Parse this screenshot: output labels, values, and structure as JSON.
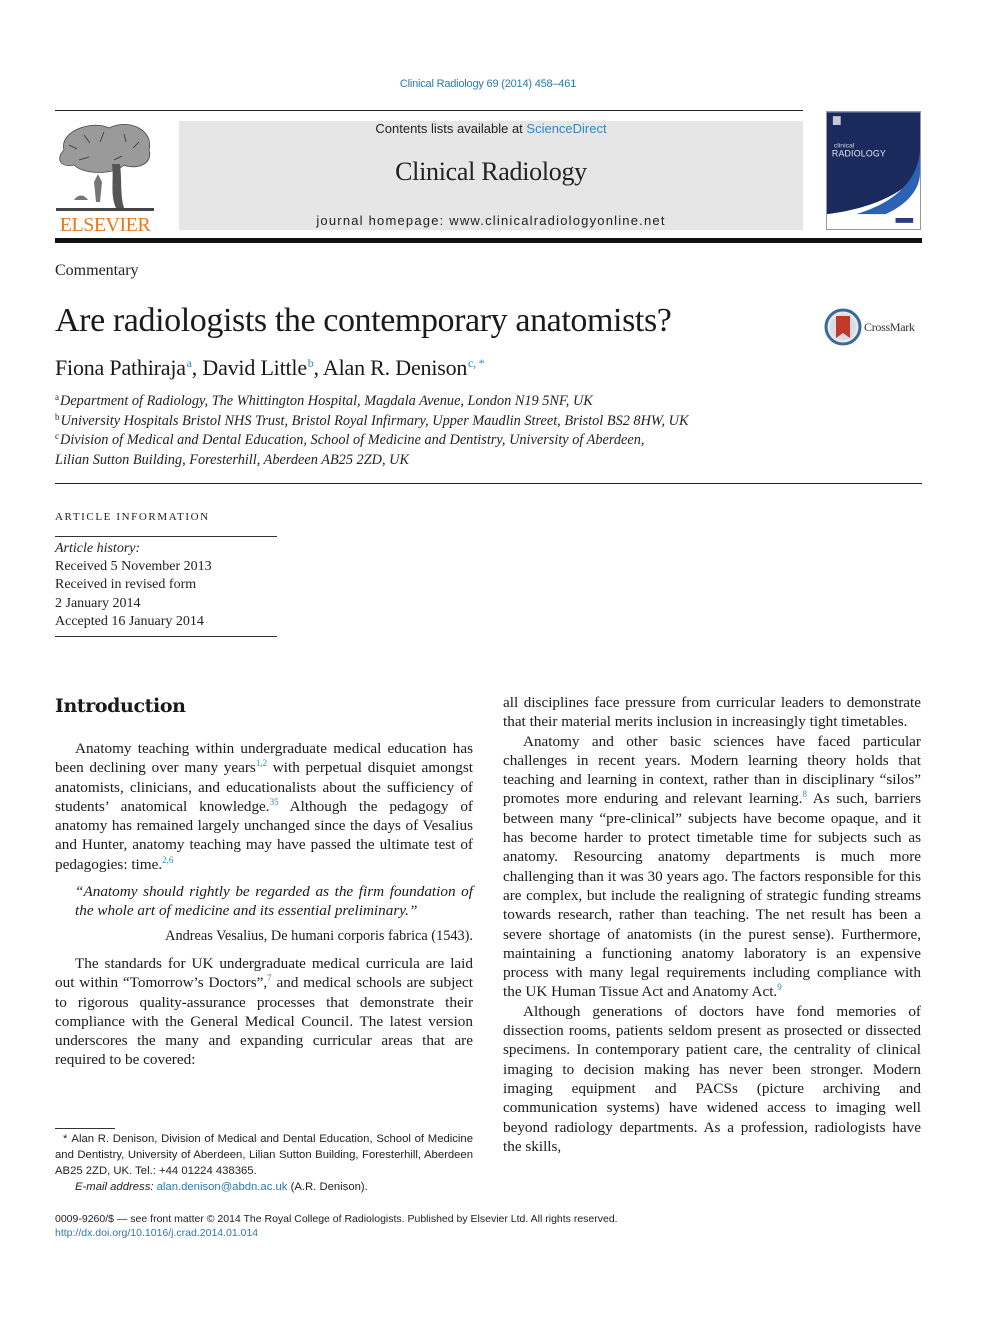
{
  "journal_ref": "Clinical Radiology 69 (2014) 458–461",
  "header": {
    "publisher": "ELSEVIER",
    "contents_prefix": "Contents lists available at ",
    "contents_link": "ScienceDirect",
    "journal_title": "Clinical Radiology",
    "homepage": "journal homepage: www.clinicalradiologyonline.net",
    "cover_title_small": "clinical",
    "cover_title_large": "RADIOLOGY",
    "brand_color": "#e8781e",
    "cover_color": "#1b2a5c"
  },
  "article": {
    "section_type": "Commentary",
    "title": "Are radiologists the contemporary anatomists?",
    "crossmark_label": "CrossMark",
    "authors": [
      {
        "name": "Fiona Pathiraja",
        "sup": "a"
      },
      {
        "name": "David Little",
        "sup": "b"
      },
      {
        "name": "Alan R. Denison",
        "sup": "c, *"
      }
    ],
    "affiliations": [
      {
        "key": "a",
        "text": "Department of Radiology, The Whittington Hospital, Magdala Avenue, London N19 5NF, UK"
      },
      {
        "key": "b",
        "text": "University Hospitals Bristol NHS Trust, Bristol Royal Infirmary, Upper Maudlin Street, Bristol BS2 8HW, UK"
      },
      {
        "key": "c",
        "text": "Division of Medical and Dental Education, School of Medicine and Dentistry, University of Aberdeen,"
      },
      {
        "key": "",
        "text": "Lilian Sutton Building, Foresterhill, Aberdeen AB25 2ZD, UK"
      }
    ]
  },
  "article_info": {
    "heading": "ARTICLE INFORMATION",
    "history_label": "Article history:",
    "lines": [
      "Received 5 November 2013",
      "Received in revised form",
      "2 January 2014",
      "Accepted 16 January 2014"
    ]
  },
  "body": {
    "intro_heading": "Introduction",
    "p1": {
      "a": "Anatomy teaching within undergraduate medical education has been declining over many years",
      "c1": "1,2",
      "b": " with perpetual disquiet amongst anatomists, clinicians, and educationalists about the sufficiency of students’ anatomical knowledge.",
      "c2": "35",
      "c": " Although the pedagogy of anatomy has remained largely unchanged since the days of Vesalius and Hunter, anatomy teaching may have passed the ultimate test of pedagogies: time.",
      "c3": "2,6"
    },
    "quote": "“Anatomy should rightly be regarded as the firm foundation of the whole art of medicine and its essential preliminary.”",
    "quote_attribution": "Andreas Vesalius, De humani corporis fabrica (1543).",
    "p2": {
      "a": "The standards for UK undergraduate medical curricula are laid out within “Tomorrow’s Doctors”,",
      "c1": "7",
      "b": " and medical schools are subject to rigorous quality-assurance processes that demonstrate their compliance with the General Medical Council. The latest version underscores the many and expanding curricular areas that are required to be covered:"
    },
    "p2_cont": "all disciplines face pressure from curricular leaders to demonstrate that their material merits inclusion in increasingly tight timetables.",
    "p3": {
      "a": "Anatomy and other basic sciences have faced particular challenges in recent years. Modern learning theory holds that teaching and learning in context, rather than in disciplinary “silos” promotes more enduring and relevant learning.",
      "c1": "8",
      "b": " As such, barriers between many “pre-clinical” subjects have become opaque, and it has become harder to protect timetable time for subjects such as anatomy. Resourcing anatomy departments is much more challenging than it was 30 years ago. The factors responsible for this are complex, but include the realigning of strategic funding streams towards research, rather than teaching. The net result has been a severe shortage of anatomists (in the purest sense). Furthermore, maintaining a functioning anatomy laboratory is an expensive process with many legal requirements including compliance with the UK Human Tissue Act and Anatomy Act.",
      "c2": "9"
    },
    "p4": "Although generations of doctors have fond memories of dissection rooms, patients seldom present as prosected or dissected specimens. In contemporary patient care, the centrality of clinical imaging to decision making has never been stronger. Modern imaging equipment and PACSs (picture archiving and communication systems) have widened access to imaging well beyond radiology departments. As a profession, radiologists have the skills,"
  },
  "footnote": {
    "star": "*",
    "text": "Alan R. Denison, Division of Medical and Dental Education, School of Medicine and Dentistry, University of Aberdeen, Lilian Sutton Building, Foresterhill, Aberdeen AB25 2ZD, UK. Tel.: +44 01224 438365.",
    "email_label": "E-mail address:",
    "email": "alan.denison@abdn.ac.uk",
    "email_suffix": " (A.R. Denison)."
  },
  "bottom": {
    "copyright": "0009-9260/$ — see front matter © 2014 The Royal College of Radiologists. Published by Elsevier Ltd. All rights reserved.",
    "doi": "http://dx.doi.org/10.1016/j.crad.2014.01.014"
  },
  "colors": {
    "link": "#2a7ab0",
    "citation": "#2a8ac8",
    "masthead_bg": "#e6e6e6"
  }
}
